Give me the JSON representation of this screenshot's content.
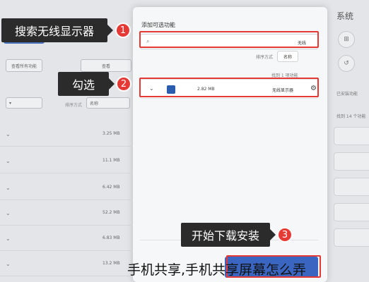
{
  "background": {
    "left_buttons": [
      "查看所有功能",
      "查看"
    ],
    "filter_label": "排序方式",
    "filter_value": "名称",
    "rows": [
      {
        "size": "3.25 MB"
      },
      {
        "size": "11.1 MB"
      },
      {
        "size": "6.42 MB"
      },
      {
        "size": "52.2 MB"
      },
      {
        "size": "6.83 MB"
      },
      {
        "size": "13.2 MB"
      }
    ],
    "right_title": "系统",
    "right_rows": [
      "已安装功能",
      "找到 14 个功能"
    ]
  },
  "dialog": {
    "title": "添加可选功能",
    "search_value": "无线",
    "sort_label": "排序方式",
    "sort_value": "名称",
    "found_text": "找到 1 项功能",
    "result": {
      "name": "无线显示器",
      "size": "2.82 MB"
    }
  },
  "callouts": [
    {
      "number": "1",
      "text": "搜索无线显示器"
    },
    {
      "number": "2",
      "text": "勾选"
    },
    {
      "number": "3",
      "text": "开始下载安装"
    }
  ],
  "caption": "手机共享,手机共享屏幕怎么弄",
  "colors": {
    "highlight": "#e53935",
    "callout_bg": "#2b2b2b",
    "accent_blue": "#3a66c1"
  },
  "icons": {
    "search": "search-icon",
    "chevron": "chevron-down-icon",
    "feature": "feature-icon"
  }
}
